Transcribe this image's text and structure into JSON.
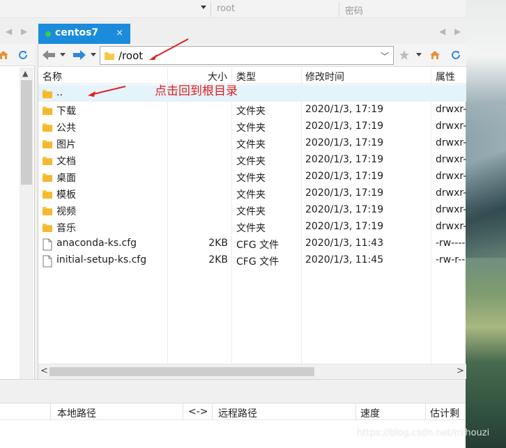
{
  "top_bar": {
    "username": "root",
    "password_placeholder": "密码"
  },
  "tab": {
    "title": "centos7",
    "close": "×"
  },
  "nav_glyphs": {
    "left": "◀",
    "right": "▶"
  },
  "address": {
    "path": "/root"
  },
  "columns": {
    "name": "名称",
    "size": "大小",
    "type": "类型",
    "modified": "修改时间",
    "attributes": "属性"
  },
  "files": [
    {
      "name": "..",
      "size": "",
      "type": "",
      "modified": "",
      "attributes": "",
      "icon": "folder-icon"
    },
    {
      "name": "下载",
      "size": "",
      "type": "文件夹",
      "modified": "2020/1/3, 17:19",
      "attributes": "drwxr-",
      "icon": "folder-icon"
    },
    {
      "name": "公共",
      "size": "",
      "type": "文件夹",
      "modified": "2020/1/3, 17:19",
      "attributes": "drwxr-",
      "icon": "folder-icon"
    },
    {
      "name": "图片",
      "size": "",
      "type": "文件夹",
      "modified": "2020/1/3, 17:19",
      "attributes": "drwxr-",
      "icon": "folder-icon"
    },
    {
      "name": "文档",
      "size": "",
      "type": "文件夹",
      "modified": "2020/1/3, 17:19",
      "attributes": "drwxr-",
      "icon": "folder-icon"
    },
    {
      "name": "桌面",
      "size": "",
      "type": "文件夹",
      "modified": "2020/1/3, 17:19",
      "attributes": "drwxr-",
      "icon": "folder-icon"
    },
    {
      "name": "模板",
      "size": "",
      "type": "文件夹",
      "modified": "2020/1/3, 17:19",
      "attributes": "drwxr-",
      "icon": "folder-icon"
    },
    {
      "name": "视频",
      "size": "",
      "type": "文件夹",
      "modified": "2020/1/3, 17:19",
      "attributes": "drwxr-",
      "icon": "folder-icon"
    },
    {
      "name": "音乐",
      "size": "",
      "type": "文件夹",
      "modified": "2020/1/3, 17:19",
      "attributes": "drwxr-",
      "icon": "folder-icon"
    },
    {
      "name": "anaconda-ks.cfg",
      "size": "2KB",
      "type": "CFG 文件",
      "modified": "2020/1/3, 11:43",
      "attributes": "-rw----",
      "icon": "file-icon"
    },
    {
      "name": "initial-setup-ks.cfg",
      "size": "2KB",
      "type": "CFG 文件",
      "modified": "2020/1/3, 11:45",
      "attributes": "-rw-r--",
      "icon": "file-icon"
    }
  ],
  "annotation": {
    "text": "点击回到根目录"
  },
  "queue": {
    "local_path": "本地路径",
    "direction": "<->",
    "remote_path": "远程路径",
    "speed": "速度",
    "remaining": "估计剩余"
  },
  "watermark": "https://blog.csdn.net/mihouzi",
  "colors": {
    "tab_active": "#1b8bdb",
    "connected_dot": "#3ccb4b",
    "annotation_red": "#e02020",
    "selected_row": "#e5f3fb",
    "folder_yellow": "#f7c948"
  }
}
